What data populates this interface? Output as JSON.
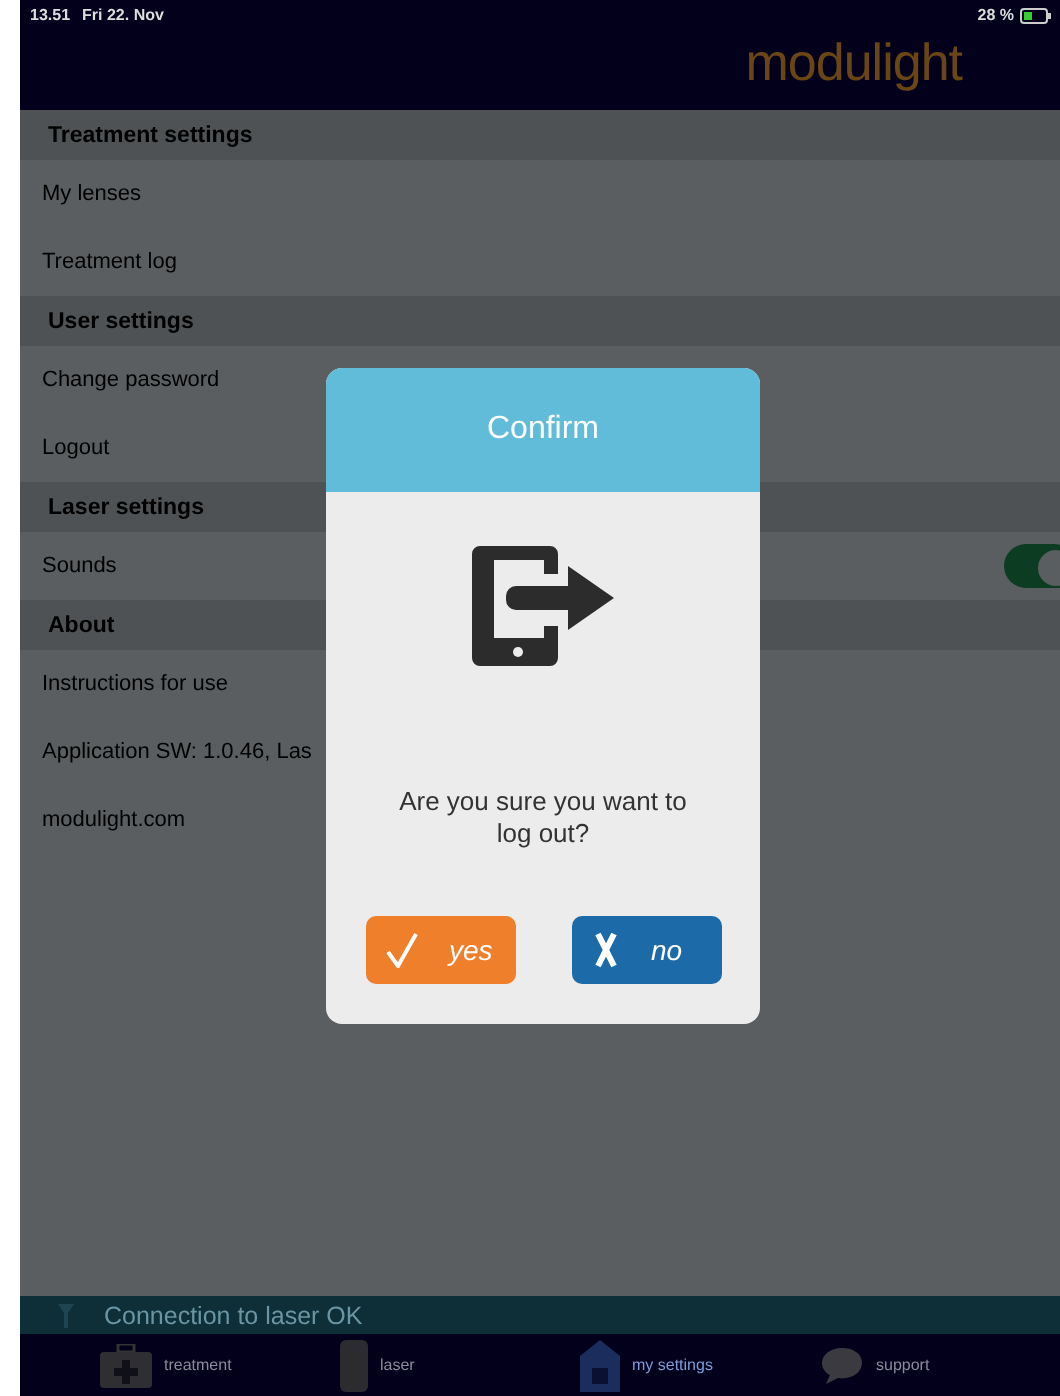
{
  "status_bar": {
    "time": "13.51",
    "date": "Fri 22. Nov",
    "battery": "28 %"
  },
  "header": {
    "logo": "modulight"
  },
  "sections": [
    {
      "title": "Treatment settings",
      "items": [
        {
          "label": "My lenses"
        },
        {
          "label": "Treatment log"
        }
      ]
    },
    {
      "title": "User settings",
      "items": [
        {
          "label": "Change password"
        },
        {
          "label": "Logout"
        }
      ]
    },
    {
      "title": "Laser settings",
      "items": [
        {
          "label": "Sounds",
          "kind": "toggle",
          "on": true
        }
      ]
    },
    {
      "title": "About",
      "items": [
        {
          "label": "Instructions for use"
        },
        {
          "label": "Application SW: 1.0.46, Las"
        },
        {
          "label": "modulight.com"
        }
      ]
    }
  ],
  "connection": {
    "text": "Connection to laser OK"
  },
  "tab_bar": [
    {
      "label": "treatment",
      "selected": false
    },
    {
      "label": "laser",
      "selected": false
    },
    {
      "label": "my settings",
      "selected": true
    },
    {
      "label": "support",
      "selected": false
    }
  ],
  "dialog": {
    "title": "Confirm",
    "message": "Are you sure you want to log out?",
    "buttons": [
      {
        "label": "yes",
        "kind": "confirm"
      },
      {
        "label": "no",
        "kind": "cancel"
      }
    ]
  }
}
